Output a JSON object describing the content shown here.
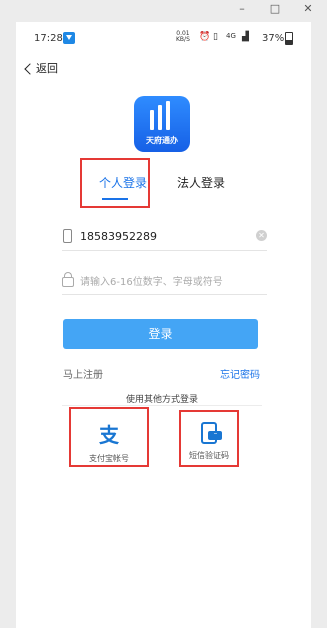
{
  "statusbar": {
    "time": "17:28",
    "net_speed_value": "0.01",
    "net_speed_unit": "KB/S",
    "battery": "37%"
  },
  "nav": {
    "back_label": "返回"
  },
  "logo": {
    "text": "天府通办"
  },
  "tabs": [
    {
      "label": "个人登录",
      "active": true
    },
    {
      "label": "法人登录",
      "active": false
    }
  ],
  "form": {
    "phone_value": "18583952289",
    "password_placeholder": "请输入6-16位数字、字母或符号",
    "login_label": "登录"
  },
  "links": {
    "register": "马上注册",
    "forgot": "忘记密码"
  },
  "other_login": {
    "title": "使用其他方式登录",
    "options": [
      {
        "label": "支付宝帐号",
        "icon": "alipay-icon"
      },
      {
        "label": "短信验证码",
        "icon": "sms-icon"
      }
    ]
  },
  "colors": {
    "accent": "#1a73e8",
    "button": "#44a5f5",
    "highlight": "#e53935"
  }
}
